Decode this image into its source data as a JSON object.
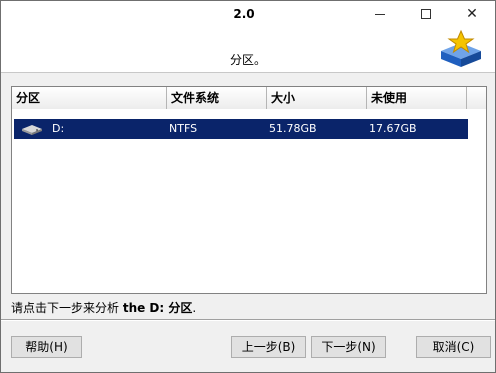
{
  "window": {
    "title": "2.0",
    "subtitle": "分区。",
    "minimize_icon": "minimize-icon",
    "maximize_icon": "maximize-icon",
    "close_icon": "close-icon",
    "close_glyph": "✕"
  },
  "table": {
    "columns": [
      "分区",
      "文件系统",
      "大小",
      "未使用"
    ],
    "rows": [
      {
        "partition": "D:",
        "filesystem": "NTFS",
        "size": "51.78GB",
        "unused": "17.67GB",
        "icon": "drive-icon"
      }
    ]
  },
  "hint": {
    "prefix": "请点击下一步来分析 ",
    "bold": "the D: 分区",
    "suffix": "."
  },
  "buttons": {
    "help": "帮助(H)",
    "back": "上一步(B)",
    "next": "下一步(N)",
    "cancel": "取消(C)"
  },
  "colors": {
    "selection": "#0a246a",
    "logo_blue": "#1f5fbf",
    "logo_star": "#f5c400"
  }
}
